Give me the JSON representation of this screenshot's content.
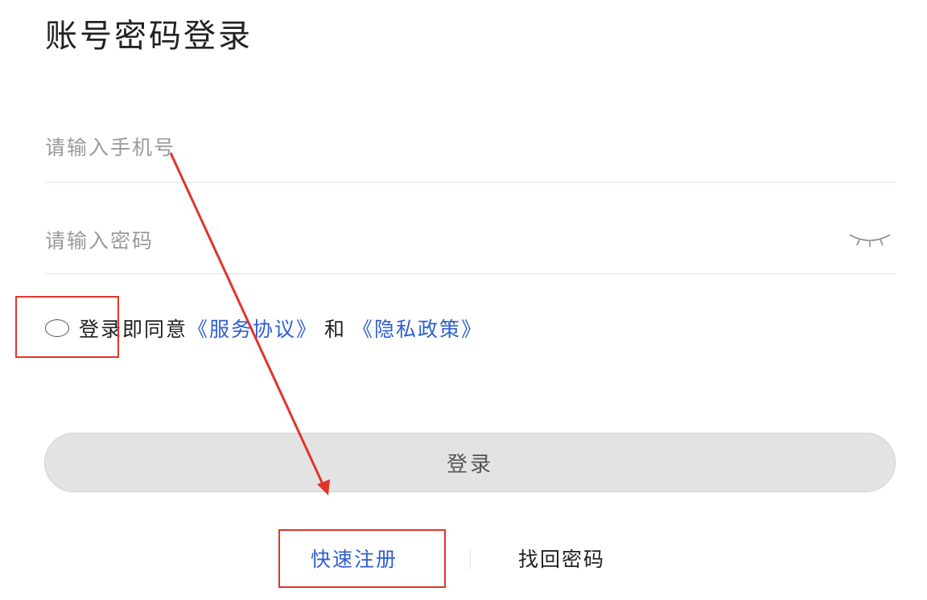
{
  "page": {
    "title": "账号密码登录"
  },
  "form": {
    "phone_placeholder": "请输入手机号",
    "password_placeholder": "请输入密码",
    "eye_icon": "eye-closed-icon"
  },
  "agreement": {
    "checked": false,
    "prefix": "登录即同意",
    "service_link": "《服务协议》",
    "and": "和",
    "privacy_link": "《隐私政策》"
  },
  "actions": {
    "login_label": "登录",
    "register_label": "快速注册",
    "forgot_label": "找回密码"
  },
  "colors": {
    "link": "#2f5fd0",
    "annotation": "#e0342a",
    "button_bg": "#e3e3e3"
  }
}
